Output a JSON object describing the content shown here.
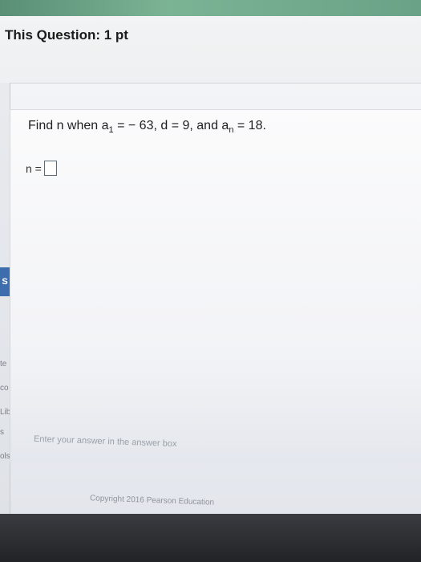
{
  "header": {
    "title": "This Question: 1 pt"
  },
  "question": {
    "prefix": "Find n when a",
    "sub1": "1",
    "middle": " = − 63, d = 9, and a",
    "sub2": "n",
    "suffix": " = 18."
  },
  "answer": {
    "label": "n =",
    "value": ""
  },
  "sidebar": {
    "tab": "S",
    "labels": [
      "te",
      "co",
      "Lib",
      "s",
      "ols"
    ]
  },
  "footer": {
    "hint": "Enter your answer in the answer box",
    "copyright": "Copyright 2016 Pearson Education"
  },
  "colors": {
    "accent_green": "#6aa287",
    "tab_blue": "#3e6dad"
  }
}
